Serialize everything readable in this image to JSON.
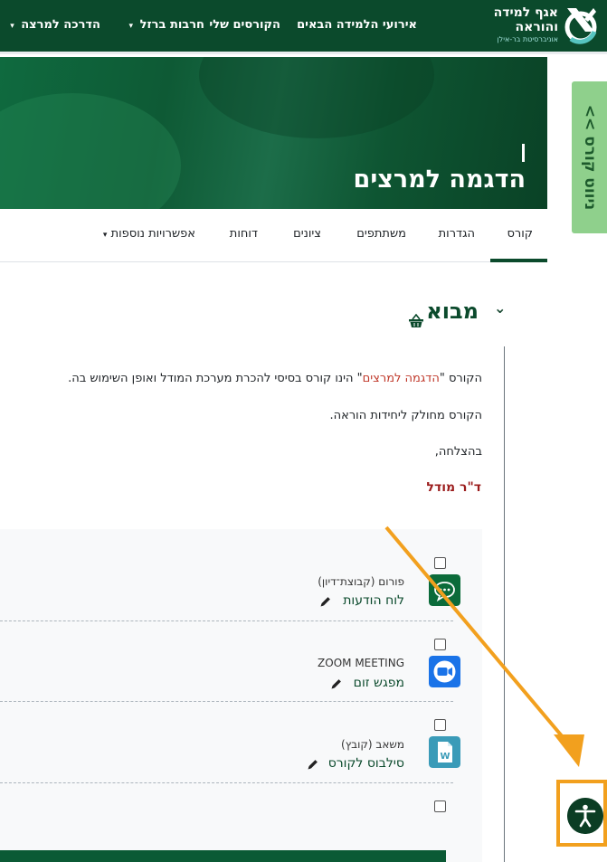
{
  "header": {
    "brand_line1": "אגף למידה",
    "brand_line2": "והוראה",
    "brand_line3": "אוניברסיטת בר-אילן",
    "nav": [
      {
        "label": "אירועי הלמידה הבאים",
        "dropdown": false
      },
      {
        "label": "הקורסים שלי",
        "dropdown": false
      },
      {
        "label": "חרבות ברזל",
        "dropdown": true
      },
      {
        "label": "הדרכה למרצה",
        "dropdown": true
      }
    ]
  },
  "hero": {
    "course_title": "הדגמה למרצים"
  },
  "side_tab": {
    "label": "<< ניווט קורס"
  },
  "course_nav": {
    "tabs": [
      {
        "label": "קורס",
        "active": true
      },
      {
        "label": "הגדרות",
        "active": false
      },
      {
        "label": "משתתפים",
        "active": false
      },
      {
        "label": "ציונים",
        "active": false
      },
      {
        "label": "דוחות",
        "active": false
      },
      {
        "label": "אפשרויות נוספות",
        "active": false,
        "dropdown": true
      }
    ]
  },
  "section": {
    "title": "מבוא",
    "intro_prefix": "הקורס \"",
    "intro_highlight": "הדגמה למרצים",
    "intro_suffix": "\" הינו קורס בסיסי להכרת מערכת המודל ואופן השימוש בה.",
    "line2": "הקורס מחולק ליחידות הוראה.",
    "line3": "בהצלחה,",
    "signature": "ד\"ר מודל"
  },
  "activities": [
    {
      "type": "פורום (קבוצת־דיון)",
      "name": "לוח הודעות",
      "icon": "forum-icon",
      "color": "#0b6b3a"
    },
    {
      "type": "ZOOM MEETING",
      "name": "מפגש זום",
      "icon": "zoom-icon",
      "color": "#1a73e8"
    },
    {
      "type": "משאב (קובץ)",
      "name": "סילבוס לקורס",
      "icon": "word-file-icon",
      "color": "#3a9bb8"
    }
  ],
  "colors": {
    "brand_green": "#0b4a2c",
    "side_tab": "#8fd08c",
    "highlight_red": "#c0392b",
    "annotation_orange": "#f2a01e"
  }
}
